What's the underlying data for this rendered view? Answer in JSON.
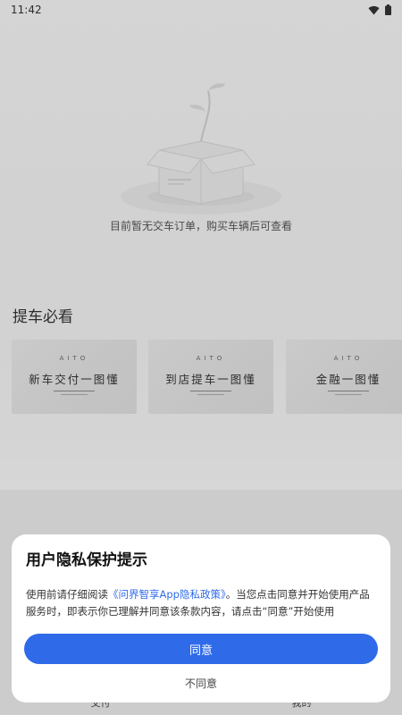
{
  "status_bar": {
    "time": "11:42",
    "icons": [
      "wifi-icon",
      "battery-icon"
    ]
  },
  "empty_state": {
    "message": "目前暂无交车订单，购买车辆后可查看",
    "illustration": "empty-box-icon"
  },
  "pickup_section": {
    "title": "提车必看",
    "cards": [
      {
        "brand": "AITO",
        "title": "新车交付一图懂"
      },
      {
        "brand": "AITO",
        "title": "到店提车一图懂"
      },
      {
        "brand": "AITO",
        "title": "金融一图懂"
      }
    ]
  },
  "bottom_nav": {
    "items": [
      "交付",
      "我的"
    ]
  },
  "privacy_dialog": {
    "title": "用户隐私保护提示",
    "body_prefix": "使用前请仔细阅读",
    "policy_link": "《问界智享App隐私政策》",
    "body_suffix": "。当您点击同意并开始使用产品服务时，即表示你已理解并同意该条款内容，请点击“同意”开始使用",
    "agree_label": "同意",
    "disagree_label": "不同意"
  },
  "colors": {
    "accent": "#2f6be8",
    "dialog_bg": "#ffffff",
    "page_bg": "#efefef"
  }
}
